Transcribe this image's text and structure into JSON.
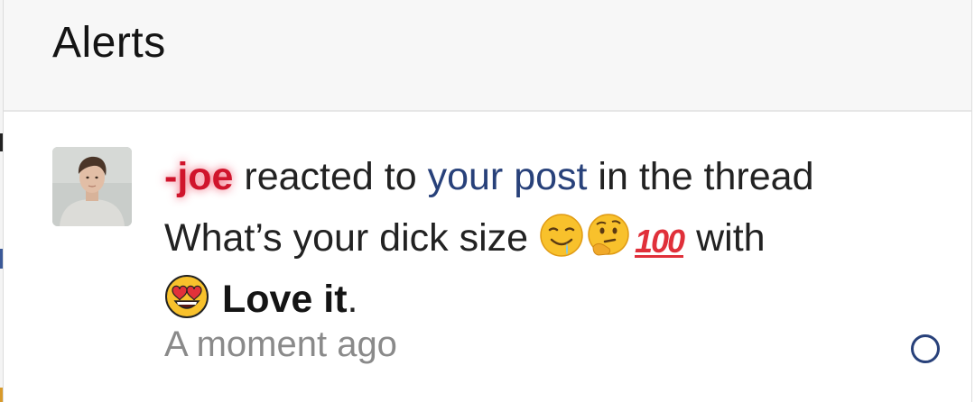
{
  "panel": {
    "title": "Alerts"
  },
  "alert": {
    "username": "-joe",
    "text_reacted": "reacted to",
    "link_text": "your post",
    "text_in_thread": "in the thread",
    "thread_title": "What’s your dick size",
    "thread_emojis": [
      "drooling-face-emoji",
      "thinking-face-emoji",
      "hundred-points-emoji"
    ],
    "text_with": "with",
    "reaction_icon": "heart-eyes-emoji",
    "reaction_name": "Love it",
    "period": ".",
    "timestamp": "A moment ago",
    "unread_icon": "unread-circle-icon"
  },
  "colors": {
    "username": "#d0142c",
    "link": "#28417a",
    "timestamp": "#8a8a8a",
    "header_bg": "#f7f7f7"
  }
}
